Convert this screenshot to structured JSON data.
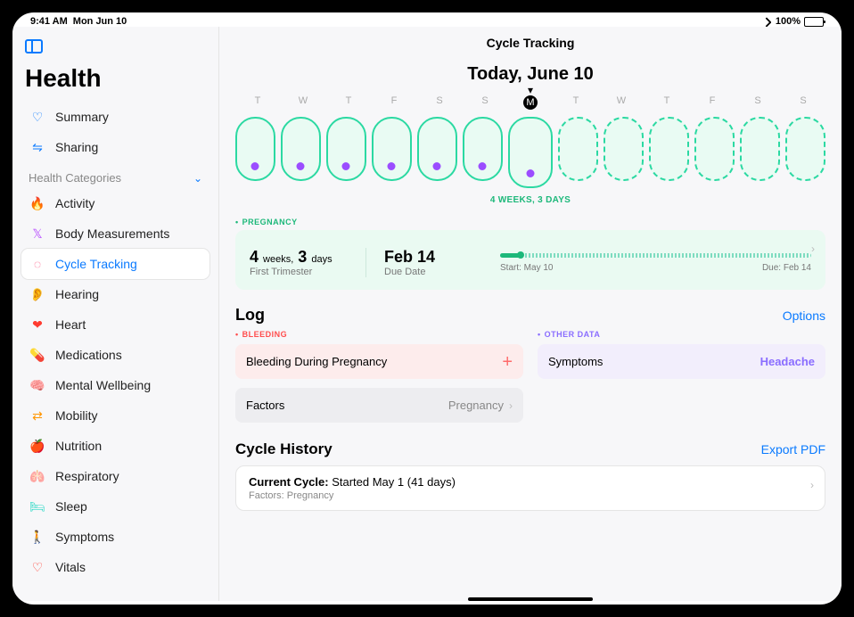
{
  "status": {
    "time": "9:41 AM",
    "date": "Mon Jun 10",
    "battery": "100%"
  },
  "app_title": "Health",
  "nav": {
    "summary": "Summary",
    "sharing": "Sharing",
    "categories_header": "Health Categories"
  },
  "categories": [
    {
      "label": "Activity",
      "icon": "🔥",
      "color": "#ff6a2c"
    },
    {
      "label": "Body Measurements",
      "icon": "𝕏",
      "color": "#b84dff"
    },
    {
      "label": "Cycle Tracking",
      "icon": "◌",
      "color": "#ff4d7a",
      "selected": true
    },
    {
      "label": "Hearing",
      "icon": "👂",
      "color": "#0a7aff"
    },
    {
      "label": "Heart",
      "icon": "❤",
      "color": "#ff3b30"
    },
    {
      "label": "Medications",
      "icon": "💊",
      "color": "#2bc3d9"
    },
    {
      "label": "Mental Wellbeing",
      "icon": "🧠",
      "color": "#2bd9a2"
    },
    {
      "label": "Mobility",
      "icon": "⇄",
      "color": "#ff9500"
    },
    {
      "label": "Nutrition",
      "icon": "🍎",
      "color": "#2bd96a"
    },
    {
      "label": "Respiratory",
      "icon": "🫁",
      "color": "#0a7aff"
    },
    {
      "label": "Sleep",
      "icon": "🛏",
      "color": "#2bd9c5"
    },
    {
      "label": "Symptoms",
      "icon": "🚶",
      "color": "#5a8cff"
    },
    {
      "label": "Vitals",
      "icon": "♡",
      "color": "#ff3b30"
    }
  ],
  "main": {
    "page_title": "Cycle Tracking",
    "today_title": "Today, June 10",
    "day_letters": [
      "T",
      "W",
      "T",
      "F",
      "S",
      "S",
      "M",
      "T",
      "W",
      "T",
      "F",
      "S",
      "S"
    ],
    "today_index": 6,
    "gestational_age": "4 WEEKS, 3 DAYS"
  },
  "pregnancy": {
    "tag": "PREGNANCY",
    "weeks_value": "4",
    "weeks_unit": "weeks,",
    "days_value": "3",
    "days_unit": "days",
    "trimester": "First Trimester",
    "due_date": "Feb 14",
    "due_label": "Due Date",
    "start_label": "Start: May 10",
    "due_label_right": "Due: Feb 14"
  },
  "log": {
    "title": "Log",
    "options": "Options",
    "bleeding_tag": "BLEEDING",
    "bleeding_row": "Bleeding During Pregnancy",
    "other_tag": "OTHER DATA",
    "symptoms_label": "Symptoms",
    "symptoms_value": "Headache",
    "factors_label": "Factors",
    "factors_value": "Pregnancy"
  },
  "history": {
    "title": "Cycle History",
    "export": "Export PDF",
    "current_label": "Current Cycle:",
    "current_value": "Started May 1 (41 days)",
    "factors_label": "Factors:",
    "factors_value": "Pregnancy"
  }
}
